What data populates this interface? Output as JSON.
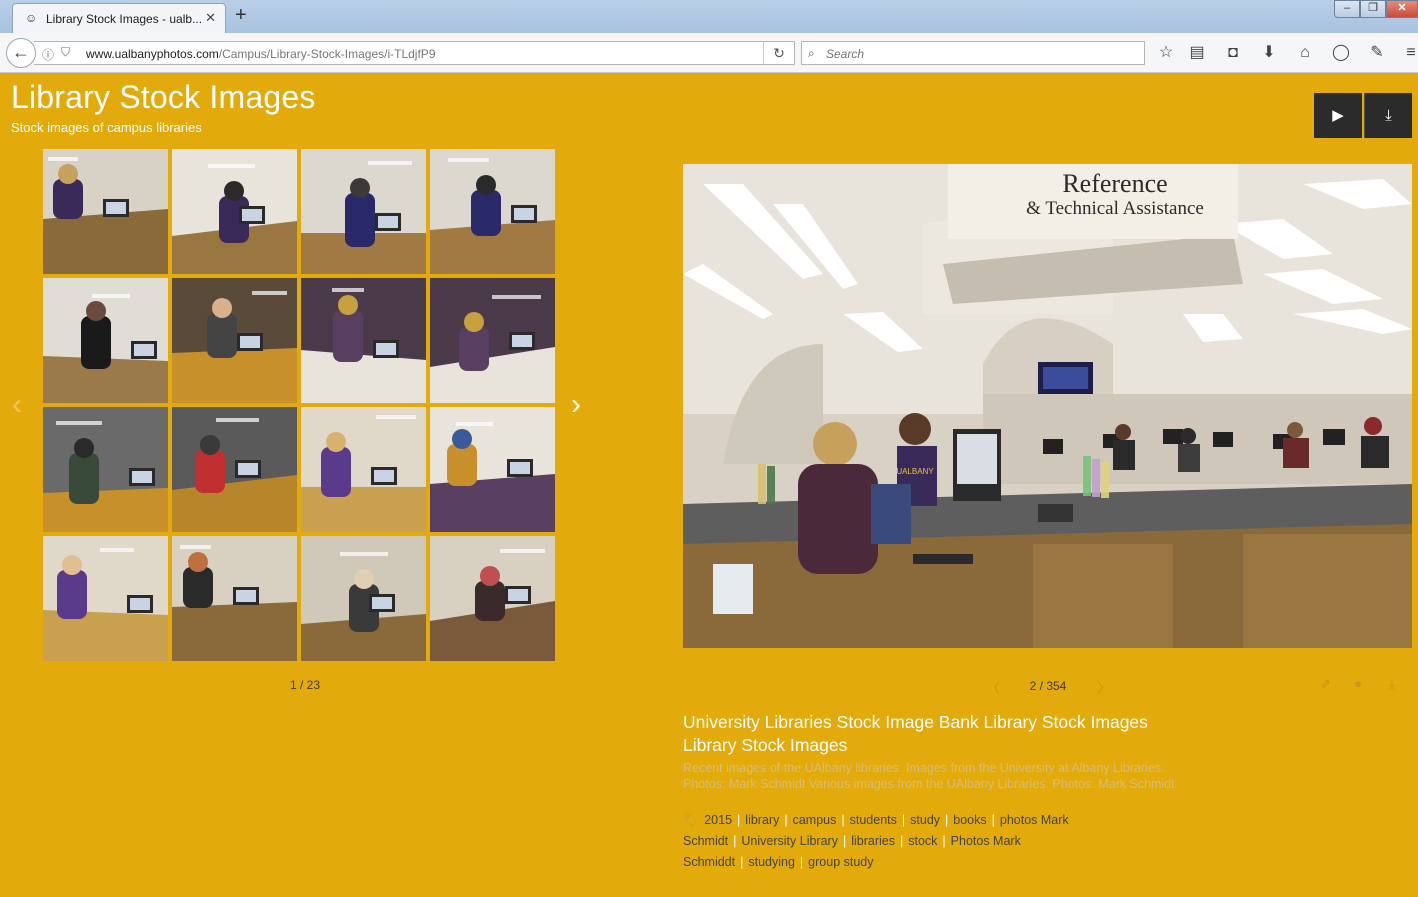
{
  "browser": {
    "tab_title": "Library Stock Images - ualb...",
    "url_domain": "www.ualbanyphotos.com",
    "url_path": "/Campus/Library-Stock-Images/i-TLdjfP9",
    "search_placeholder": "Search",
    "icons": {
      "tab": "smiley-favicon-icon",
      "close_tab": "close-icon",
      "new_tab": "plus-icon",
      "back": "back-arrow-icon",
      "reload": "reload-icon",
      "tools": [
        "star-icon",
        "reading-list-icon",
        "pocket-icon",
        "download-icon",
        "home-icon",
        "chat-icon",
        "pen-icon",
        "menu-icon"
      ]
    }
  },
  "header": {
    "title": "Library Stock Images",
    "subtitle": "Stock images of campus libraries",
    "slideshow_icon": "▶",
    "download_icon": "⤓"
  },
  "gallery": {
    "counter": "1 / 23",
    "thumbnails": [
      "reference-desk-student",
      "reference-sign-desk",
      "university-library-desk",
      "university-library-desk-wide",
      "library-desk-patron",
      "student-laptop-table",
      "reading-room-overhead",
      "reading-room-overhead-2",
      "student-hoodie-laptop",
      "two-students-laptop",
      "smiling-student-pointing",
      "study-tables-overhead",
      "student-typing-smile",
      "group-study-laptops",
      "group-study-wide",
      "group-study-close"
    ]
  },
  "photo": {
    "counter": "2 / 354",
    "sign_line1": "Reference",
    "sign_line2": "& Technical Assistance",
    "caption": "University Libraries Stock Image Bank Library Stock Images Library Stock Images",
    "description": "Recent images of the UAlbany libraries. Images from the University at Albany Libraries. Photos: Mark Schmidt Various images from the UAlbany Libraries. Photos: Mark Schmidt",
    "keywords": [
      "2015",
      "library",
      "campus",
      "students",
      "study",
      "books",
      "photos Mark Schmidt",
      "University Library",
      "libraries",
      "stock",
      "Photos Mark Schmiddt",
      "studying",
      "group study"
    ]
  },
  "colors": {
    "page_background": "#e2aa0b",
    "button_dark": "#2b2b2b",
    "accent_text": "#ffffff"
  }
}
